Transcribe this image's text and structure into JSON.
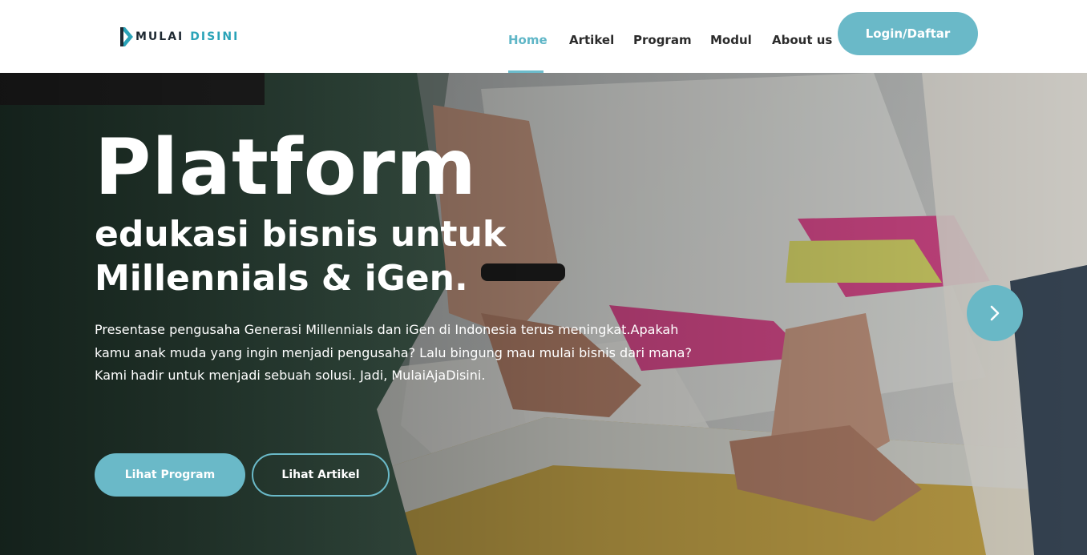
{
  "logo": {
    "word1": "MULAI",
    "word2": "DISINI",
    "mark_icon": "chevron-right-logo-mark"
  },
  "nav": {
    "items": [
      {
        "label": "Home",
        "active": true
      },
      {
        "label": "Artikel",
        "active": false
      },
      {
        "label": "Program",
        "active": false
      },
      {
        "label": "Modul",
        "active": false
      },
      {
        "label": "About us",
        "active": false
      }
    ],
    "login_label": "Login/Daftar"
  },
  "hero": {
    "title": "Platform",
    "subtitle_line1": "edukasi bisnis untuk",
    "subtitle_line2": "Millennials & iGen.",
    "description": "Presentase pengusaha Generasi Millennials dan iGen di Indonesia terus meningkat.Apakah kamu anak muda yang ingin menjadi pengusaha? Lalu bingung mau mulai bisnis dari mana? Kami hadir untuk menjadi sebuah solusi. Jadi, MulaiAjaDisini.",
    "primary_button": "Lihat Program",
    "secondary_button": "Lihat Artikel",
    "next_icon": "chevron-right-icon",
    "background_image": "photo-of-hands-on-table-with-papers"
  },
  "colors": {
    "accent": "#6ab9c8",
    "nav_active": "#5fb6c7",
    "logo_dark": "#1f2a33",
    "logo_teal": "#2aa3b8"
  }
}
